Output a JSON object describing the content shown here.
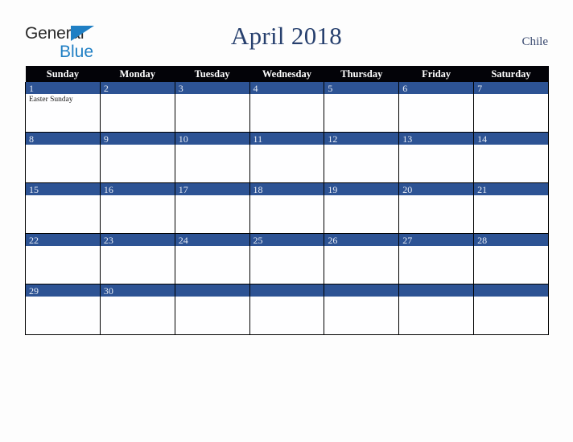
{
  "brand": {
    "name_part1": "General",
    "name_part2": "Blue",
    "triangle_color": "#1f7fc4"
  },
  "header": {
    "title": "April 2018",
    "country": "Chile"
  },
  "colors": {
    "header_row_bg": "#030308",
    "date_band_bg": "#2d5394",
    "title_color": "#27406e",
    "page_bg": "#fdfdfd",
    "grid_border": "#000000"
  },
  "calendar": {
    "month": "April",
    "year": "2018",
    "weekday_headers": [
      "Sunday",
      "Monday",
      "Tuesday",
      "Wednesday",
      "Thursday",
      "Friday",
      "Saturday"
    ],
    "weeks": [
      [
        {
          "day": "1",
          "events": [
            "Easter Sunday"
          ]
        },
        {
          "day": "2",
          "events": []
        },
        {
          "day": "3",
          "events": []
        },
        {
          "day": "4",
          "events": []
        },
        {
          "day": "5",
          "events": []
        },
        {
          "day": "6",
          "events": []
        },
        {
          "day": "7",
          "events": []
        }
      ],
      [
        {
          "day": "8",
          "events": []
        },
        {
          "day": "9",
          "events": []
        },
        {
          "day": "10",
          "events": []
        },
        {
          "day": "11",
          "events": []
        },
        {
          "day": "12",
          "events": []
        },
        {
          "day": "13",
          "events": []
        },
        {
          "day": "14",
          "events": []
        }
      ],
      [
        {
          "day": "15",
          "events": []
        },
        {
          "day": "16",
          "events": []
        },
        {
          "day": "17",
          "events": []
        },
        {
          "day": "18",
          "events": []
        },
        {
          "day": "19",
          "events": []
        },
        {
          "day": "20",
          "events": []
        },
        {
          "day": "21",
          "events": []
        }
      ],
      [
        {
          "day": "22",
          "events": []
        },
        {
          "day": "23",
          "events": []
        },
        {
          "day": "24",
          "events": []
        },
        {
          "day": "25",
          "events": []
        },
        {
          "day": "26",
          "events": []
        },
        {
          "day": "27",
          "events": []
        },
        {
          "day": "28",
          "events": []
        }
      ],
      [
        {
          "day": "29",
          "events": []
        },
        {
          "day": "30",
          "events": []
        },
        {
          "day": "",
          "events": []
        },
        {
          "day": "",
          "events": []
        },
        {
          "day": "",
          "events": []
        },
        {
          "day": "",
          "events": []
        },
        {
          "day": "",
          "events": []
        }
      ]
    ]
  }
}
